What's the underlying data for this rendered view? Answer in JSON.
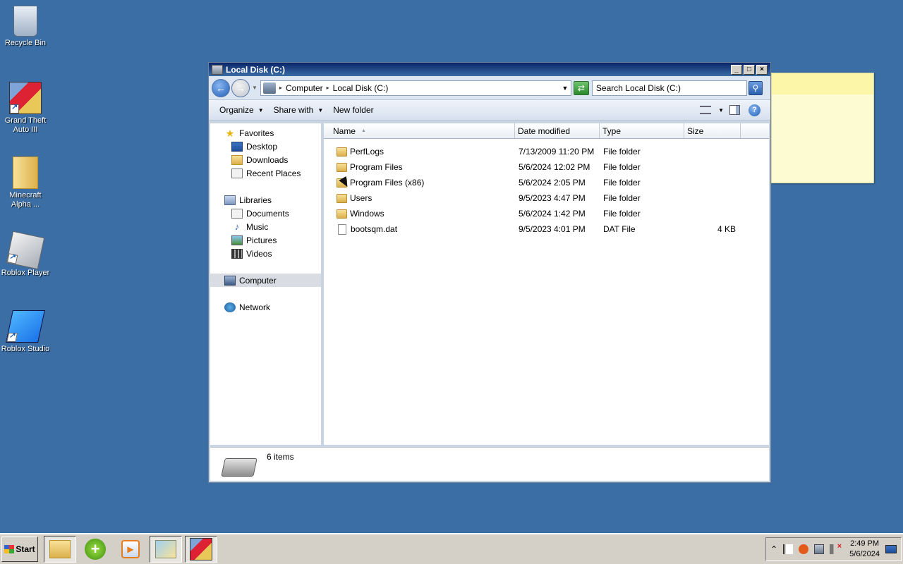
{
  "desktop": {
    "icons": [
      {
        "label": "Recycle Bin",
        "icon": "recycle-bin-icon"
      },
      {
        "label": "Grand Theft Auto III",
        "icon": "gta3-icon"
      },
      {
        "label": "Minecraft Alpha ...",
        "icon": "folder-icon"
      },
      {
        "label": "Roblox Player",
        "icon": "roblox-player-icon"
      },
      {
        "label": "Roblox Studio",
        "icon": "roblox-studio-icon"
      }
    ]
  },
  "window": {
    "title": "Local Disk (C:)",
    "controls": {
      "minimize": "_",
      "maximize": "□",
      "close": "×"
    },
    "address": {
      "crumbs": [
        "Computer",
        "Local Disk (C:)"
      ],
      "search_placeholder": "Search Local Disk (C:)"
    },
    "toolbar": {
      "organize": "Organize",
      "share_with": "Share with",
      "new_folder": "New folder"
    },
    "nav": {
      "favorites": "Favorites",
      "favorites_items": [
        "Desktop",
        "Downloads",
        "Recent Places"
      ],
      "libraries": "Libraries",
      "libraries_items": [
        "Documents",
        "Music",
        "Pictures",
        "Videos"
      ],
      "computer": "Computer",
      "network": "Network"
    },
    "columns": {
      "name": "Name",
      "date": "Date modified",
      "type": "Type",
      "size": "Size"
    },
    "files": [
      {
        "name": "PerfLogs",
        "date": "7/13/2009 11:20 PM",
        "type": "File folder",
        "size": "",
        "kind": "folder"
      },
      {
        "name": "Program Files",
        "date": "5/6/2024 12:02 PM",
        "type": "File folder",
        "size": "",
        "kind": "folder"
      },
      {
        "name": "Program Files (x86)",
        "date": "5/6/2024 2:05 PM",
        "type": "File folder",
        "size": "",
        "kind": "folder"
      },
      {
        "name": "Users",
        "date": "9/5/2023 4:47 PM",
        "type": "File folder",
        "size": "",
        "kind": "folder"
      },
      {
        "name": "Windows",
        "date": "5/6/2024 1:42 PM",
        "type": "File folder",
        "size": "",
        "kind": "folder"
      },
      {
        "name": "bootsqm.dat",
        "date": "9/5/2023 4:01 PM",
        "type": "DAT File",
        "size": "4 KB",
        "kind": "file"
      }
    ],
    "status": {
      "count": "6 items"
    }
  },
  "taskbar": {
    "start_label": "Start",
    "clock_time": "2:49 PM",
    "clock_date": "5/6/2024",
    "apps": [
      "explorer-icon",
      "plus-icon",
      "media-player-icon",
      "folder-icon",
      "gta3-icon"
    ]
  }
}
